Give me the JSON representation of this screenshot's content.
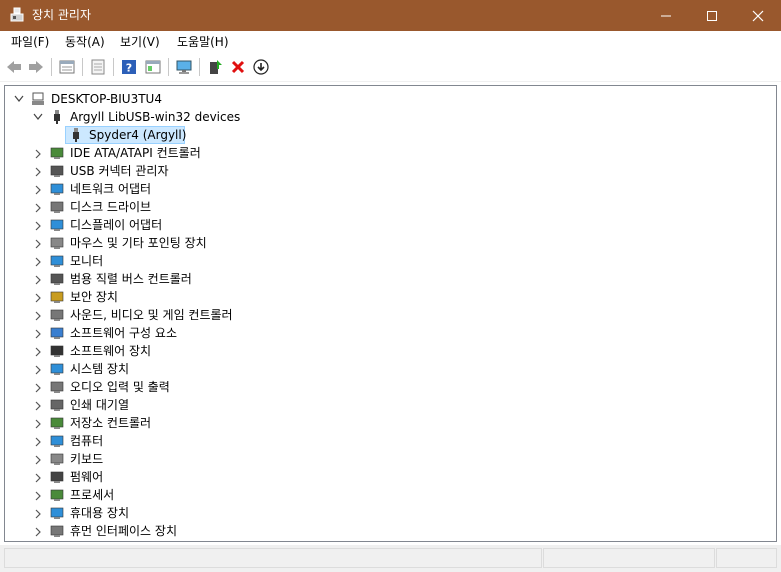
{
  "window": {
    "title": "장치 관리자",
    "accent": "#99582d"
  },
  "menu": [
    "파일(F)",
    "동작(A)",
    "보기(V)",
    "도움말(H)"
  ],
  "toolbar": {
    "icons": [
      "back-icon",
      "forward-icon",
      "properties-icon",
      "update-driver-icon",
      "help-icon",
      "view-icon",
      "monitor-scan-icon",
      "add-driver-icon",
      "uninstall-icon",
      "download-icon"
    ]
  },
  "tree": {
    "root": "DESKTOP-BIU3TU4",
    "expanded_group": "Argyll LibUSB-win32 devices",
    "selected_child": "Spyder4 (Argyll)",
    "categories": [
      "IDE ATA/ATAPI 컨트롤러",
      "USB 커넥터 관리자",
      "네트워크 어댑터",
      "디스크 드라이브",
      "디스플레이 어댑터",
      "마우스 및 기타 포인팅 장치",
      "모니터",
      "범용 직렬 버스 컨트롤러",
      "보안 장치",
      "사운드, 비디오 및 게임 컨트롤러",
      "소프트웨어 구성 요소",
      "소프트웨어 장치",
      "시스템 장치",
      "오디오 입력 및 출력",
      "인쇄 대기열",
      "저장소 컨트롤러",
      "컴퓨터",
      "키보드",
      "펌웨어",
      "프로세서",
      "휴대용 장치",
      "휴먼 인터페이스 장치"
    ],
    "category_icons": [
      "ide-controller-icon",
      "usb-connector-icon",
      "network-adapter-icon",
      "disk-drive-icon",
      "display-adapter-icon",
      "mouse-icon",
      "monitor-icon",
      "usb-controller-icon",
      "security-device-icon",
      "sound-icon",
      "software-component-icon",
      "software-device-icon",
      "system-device-icon",
      "audio-io-icon",
      "print-queue-icon",
      "storage-controller-icon",
      "computer-icon",
      "keyboard-icon",
      "firmware-icon",
      "processor-icon",
      "portable-device-icon",
      "hid-icon"
    ]
  }
}
